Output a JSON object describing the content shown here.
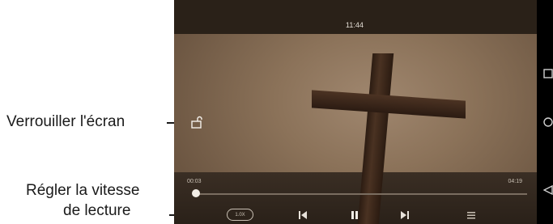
{
  "callouts": {
    "lock_label": "Verrouiller l'écran",
    "speed_label_line1": "Régler la vitesse",
    "speed_label_line2": "de lecture"
  },
  "player": {
    "title": "",
    "clock": "11:44",
    "time_elapsed": "00:03",
    "time_total": "04:19",
    "progress_fraction": 0.012,
    "speed_label": "1.0X"
  },
  "icons": {
    "lock": "unlock-icon",
    "previous": "skip-previous-icon",
    "pause": "pause-icon",
    "next": "skip-next-icon",
    "menu": "menu-icon",
    "nav_recents": "square-icon",
    "nav_home": "circle-icon",
    "nav_back": "triangle-back-icon"
  }
}
